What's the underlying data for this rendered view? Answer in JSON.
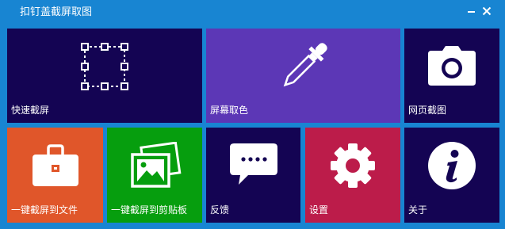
{
  "window": {
    "title": "扣钉盖截屏取图",
    "controls": [
      {
        "name": "minimize-button",
        "icon": "minus-icon"
      },
      {
        "name": "close-button",
        "icon": "close-icon"
      }
    ]
  },
  "tiles": [
    {
      "label": "快速截屏",
      "icon": "selection-frame-icon",
      "color": "#140453"
    },
    {
      "label": "屏幕取色",
      "icon": "eyedropper-icon",
      "color": "#5c37b6"
    },
    {
      "label": "网页截图",
      "icon": "camera-icon",
      "color": "#140453"
    },
    {
      "label": "一键截屏到文件",
      "icon": "briefcase-icon",
      "color": "#e0562a"
    },
    {
      "label": "一键截屏到剪贴板",
      "icon": "pictures-icon",
      "color": "#069e0e"
    },
    {
      "label": "反馈",
      "icon": "chat-bubble-icon",
      "color": "#140453"
    },
    {
      "label": "设置",
      "icon": "gear-icon",
      "color": "#bc1c4a"
    },
    {
      "label": "关于",
      "icon": "info-icon",
      "color": "#140453"
    }
  ],
  "colors": {
    "background": "#1885d2",
    "tile_dark": "#140453",
    "tile_purple": "#5c37b6",
    "tile_orange": "#e0562a",
    "tile_green": "#069e0e",
    "tile_crimson": "#bc1c4a"
  }
}
